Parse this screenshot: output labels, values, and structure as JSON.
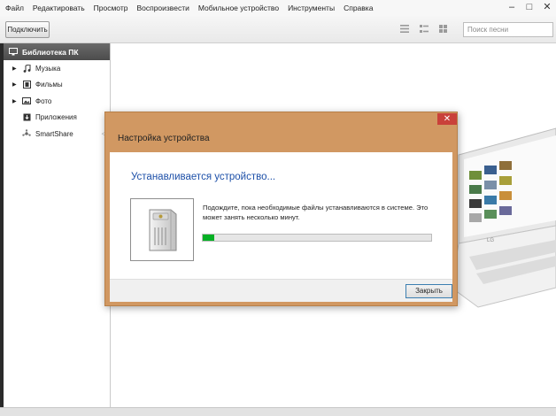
{
  "menu": {
    "items": [
      "Файл",
      "Редактировать",
      "Просмотр",
      "Воспроизвести",
      "Мобильное устройство",
      "Инструменты",
      "Справка"
    ]
  },
  "window_controls": {
    "minimize": "–",
    "maximize": "□",
    "close": "✕"
  },
  "toolbar": {
    "connect_label": "Подключить",
    "search_placeholder": "Поиск песни",
    "view_icons": [
      "list-view-icon",
      "detail-view-icon",
      "grid-view-icon"
    ]
  },
  "sidebar": {
    "header": "Библиотека ПК",
    "items": [
      {
        "label": "Музыка",
        "icon": "music-note-icon",
        "expandable": true
      },
      {
        "label": "Фильмы",
        "icon": "film-icon",
        "expandable": true
      },
      {
        "label": "Фото",
        "icon": "photo-icon",
        "expandable": true
      },
      {
        "label": "Приложения",
        "icon": "apps-download-icon",
        "expandable": false
      },
      {
        "label": "SmartShare",
        "icon": "smartshare-icon",
        "expandable": false
      }
    ]
  },
  "dialog": {
    "title": "Настройка устройства",
    "heading": "Устанавливается устройство...",
    "message": "Подождите, пока необходимые файлы устанавливаются в системе. Это может занять несколько минут.",
    "progress_percent": 5,
    "close_button": "Закрыть",
    "close_x": "✕"
  },
  "colors": {
    "dialog_frame": "#d19862",
    "dialog_close": "#c9413a",
    "heading_blue": "#1c4fa8",
    "progress_green": "#06b025",
    "sidebar_header": "#555555"
  }
}
